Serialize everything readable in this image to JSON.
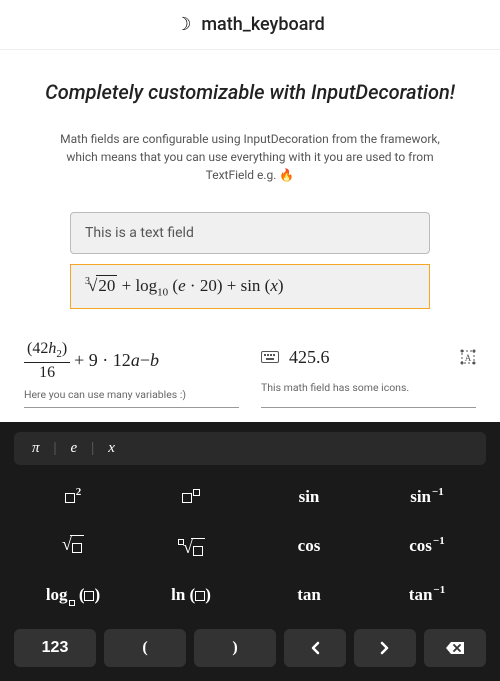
{
  "header": {
    "icon": "☽",
    "title": "math_keyboard"
  },
  "headline": "Completely customizable with InputDecoration!",
  "description": "Math fields are configurable using InputDecoration from the framework, which means that you can use everything with it you are used to from TextField e.g. 🔥",
  "textfield": {
    "placeholder": "This is a text field"
  },
  "mathfield1": {
    "radIndex": "3",
    "radicand": "20",
    "plus1": " + ",
    "log": "log",
    "logBase": "10",
    "logArgOpen": " (",
    "e": "e",
    "dot": " · ",
    "twenty": "20",
    "logArgClose": ") ",
    "plus2": "+ ",
    "sin": "sin",
    "sinArgOpen": " (",
    "x": "x",
    "sinArgClose": ")"
  },
  "expr_left": {
    "numOpen": "(",
    "num42": "42",
    "numH": "h",
    "numSub": "2",
    "numClose": ")",
    "den": "16",
    "rest1": " + 9 · 12",
    "a": "a",
    "minus": " − ",
    "b": "b",
    "helper": "Here you can use many variables :)"
  },
  "expr_right": {
    "value": "425.6",
    "helper": "This math field has some icons."
  },
  "constants": {
    "pi": "π",
    "e": "e",
    "x": "x"
  },
  "keys": {
    "square_sup": "2",
    "sin": "sin",
    "asin": "sin",
    "asin_sup": "−1",
    "cos": "cos",
    "acos": "cos",
    "acos_sup": "−1",
    "log": "log",
    "logParenL": " (",
    "logParenR": ")",
    "ln": "ln",
    "lnParenL": " (",
    "lnParenR": ")",
    "tan": "tan",
    "atan": "tan",
    "atan_sup": "−1"
  },
  "bottom": {
    "nums": "123",
    "lp": "(",
    "rp": ")",
    "left": "‹",
    "right": "›"
  }
}
